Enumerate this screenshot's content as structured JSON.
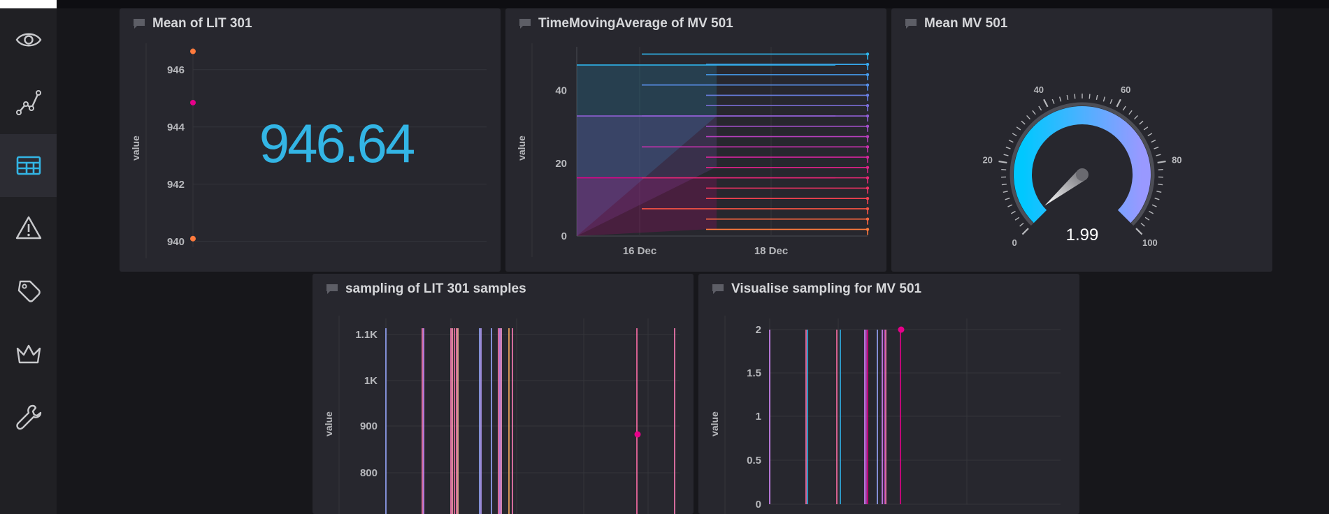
{
  "panels": {
    "mean_lit301": {
      "title": "Mean of LIT 301",
      "stat_value": "946.64"
    },
    "time_moving_avg_mv501": {
      "title": "TimeMovingAverage of MV 501"
    },
    "mean_mv501": {
      "title": "Mean MV 501"
    },
    "sampling_lit301": {
      "title": "sampling of LIT 301 samples"
    },
    "visualise_sampling_mv501": {
      "title": "Visualise sampling for MV 501"
    }
  },
  "sidebar": {
    "items": [
      {
        "icon": "eye-icon"
      },
      {
        "icon": "graph-icon"
      },
      {
        "icon": "dashboard-icon",
        "active": true
      },
      {
        "icon": "warning-icon"
      },
      {
        "icon": "tag-icon"
      },
      {
        "icon": "crown-icon"
      },
      {
        "icon": "wrench-icon"
      }
    ]
  },
  "colors": {
    "background": "#17171b",
    "panel": "#27272e",
    "sidebar": "#202024",
    "accent": "#33b5e5",
    "gauge_start": "#00c8ff",
    "gauge_end": "#9999ff",
    "magenta": "#e6008a",
    "orange": "#ff7a3d",
    "pink": "#ff7eb8"
  },
  "chart_data": [
    {
      "id": "mean_lit301",
      "type": "scatter",
      "title": "Mean of LIT 301",
      "ylabel": "value",
      "ylim": [
        939.8,
        946.8
      ],
      "yticks": [
        940,
        942,
        944,
        946
      ],
      "points": [
        {
          "y": 946.64,
          "color": "#ff7a3d"
        },
        {
          "y": 944.85,
          "color": "#e6008a"
        },
        {
          "y": 940.1,
          "color": "#ff7a3d"
        }
      ]
    },
    {
      "id": "time_moving_avg_mv501",
      "type": "line",
      "title": "TimeMovingAverage of MV 501",
      "ylabel": "value",
      "ylim": [
        0,
        52
      ],
      "yticks": [
        0,
        20,
        40
      ],
      "xticks": [
        "16 Dec",
        "18 Dec"
      ]
    },
    {
      "id": "mean_mv501",
      "type": "gauge",
      "title": "Mean MV 501",
      "value": 1.99,
      "value_label": "1.99",
      "min": 0,
      "max": 100,
      "ticks": [
        "0",
        "20",
        "40",
        "60",
        "80",
        "100"
      ]
    },
    {
      "id": "sampling_lit301",
      "type": "bar",
      "title": "sampling of LIT 301 samples",
      "ylabel": "value",
      "ylim": [
        700,
        1100
      ],
      "yticks": [
        "1.1K",
        "1K",
        "900",
        "800"
      ],
      "highlight_point": {
        "y": 880,
        "color": "#e6008a"
      }
    },
    {
      "id": "visualise_sampling_mv501",
      "type": "bar",
      "title": "Visualise sampling for MV 501",
      "ylabel": "value",
      "ylim": [
        0,
        2
      ],
      "yticks": [
        "2",
        "1.5",
        "1",
        "0.5",
        "0"
      ],
      "highlight_point": {
        "y": 2,
        "color": "#e6008a"
      }
    }
  ]
}
